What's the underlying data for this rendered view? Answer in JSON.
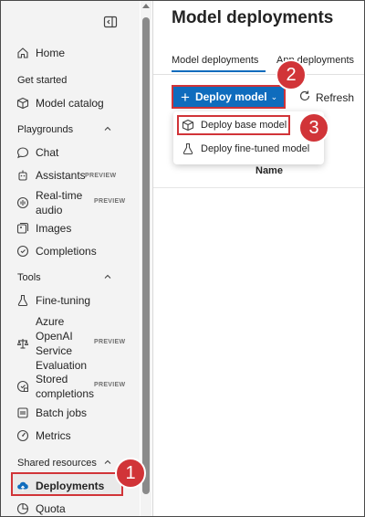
{
  "sidebar": {
    "home": "Home",
    "sections": {
      "get_started": "Get started",
      "playgrounds": "Playgrounds",
      "tools": "Tools",
      "shared_resources": "Shared resources"
    },
    "items": {
      "model_catalog": "Model catalog",
      "chat": "Chat",
      "assistants": "Assistants",
      "realtime_audio_1": "Real-time",
      "realtime_audio_2": "audio",
      "images": "Images",
      "completions": "Completions",
      "fine_tuning": "Fine-tuning",
      "aoai_eval_1": "Azure",
      "aoai_eval_2": "OpenAI",
      "aoai_eval_3": "Service",
      "aoai_eval_4": "Evaluation",
      "stored_1": "Stored",
      "stored_2": "completions",
      "batch_jobs": "Batch jobs",
      "metrics": "Metrics",
      "deployments": "Deployments",
      "quota": "Quota"
    },
    "preview_badge": "PREVIEW"
  },
  "main": {
    "title": "Model deployments",
    "tabs": [
      "Model deployments",
      "App deployments"
    ],
    "toolbar": {
      "deploy_model": "Deploy model",
      "refresh": "Refresh"
    },
    "dropdown": {
      "base": "Deploy base model",
      "fine_tuned": "Deploy fine-tuned model"
    },
    "table": {
      "col_name": "Name"
    }
  },
  "callouts": [
    "1",
    "2",
    "3"
  ],
  "colors": {
    "accent": "#0f6cbd",
    "callout": "#d13438"
  }
}
